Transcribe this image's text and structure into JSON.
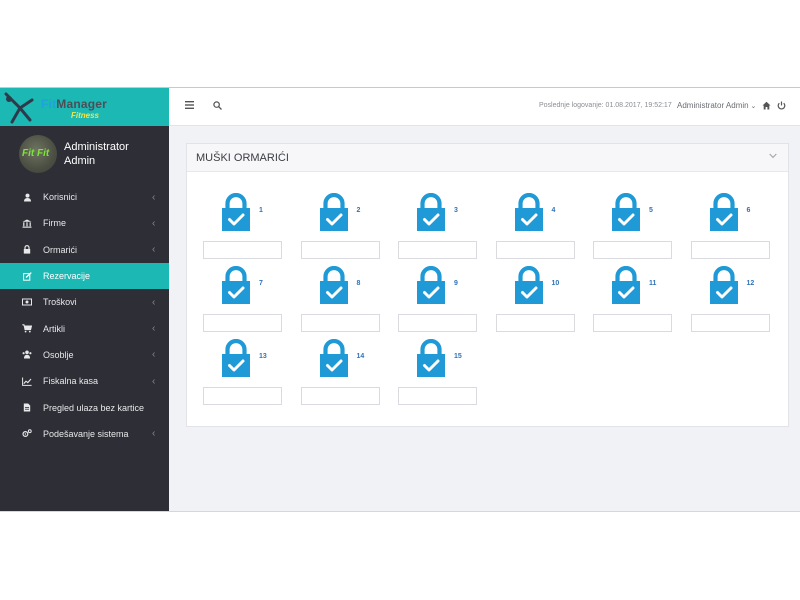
{
  "app": {
    "logo_text_blue": "Fit",
    "logo_text_gray": "Manager",
    "logo_sub": "Fitness"
  },
  "user": {
    "name": "Administrator Admin",
    "avatar_text": "Fit Fit"
  },
  "sidebar": {
    "items": [
      {
        "label": "Korisnici",
        "icon": "user-icon",
        "caret": "‹",
        "active": false
      },
      {
        "label": "Firme",
        "icon": "bank-icon",
        "caret": "‹",
        "active": false
      },
      {
        "label": "Ormarići",
        "icon": "lock-icon",
        "caret": "‹",
        "active": false
      },
      {
        "label": "Rezervacije",
        "icon": "edit-icon",
        "caret": "",
        "active": true
      },
      {
        "label": "Troškovi",
        "icon": "money-icon",
        "caret": "‹",
        "active": false
      },
      {
        "label": "Artikli",
        "icon": "cart-icon",
        "caret": "‹",
        "active": false
      },
      {
        "label": "Osoblje",
        "icon": "users-icon",
        "caret": "‹",
        "active": false
      },
      {
        "label": "Fiskalna kasa",
        "icon": "chart-line-icon",
        "caret": "‹",
        "active": false
      },
      {
        "label": "Pregled ulaza bez kartice",
        "icon": "document-icon",
        "caret": "",
        "active": false
      },
      {
        "label": "Podešavanje sistema",
        "icon": "cogs-icon",
        "caret": "‹",
        "active": false
      }
    ]
  },
  "topbar": {
    "last_login": "Poslednje logovanje: 01.08.2017, 19:52:17",
    "admin_label": "Administrator Admin"
  },
  "panel": {
    "title": "MUŠKI ORMARIĆI",
    "lockers": [
      "1",
      "2",
      "3",
      "4",
      "5",
      "6",
      "7",
      "8",
      "9",
      "10",
      "11",
      "12",
      "13",
      "14",
      "15"
    ]
  },
  "colors": {
    "sidebar_bg": "#2d2e36",
    "accent": "#1cb8b4",
    "lock_blue": "#1f9ad6"
  }
}
